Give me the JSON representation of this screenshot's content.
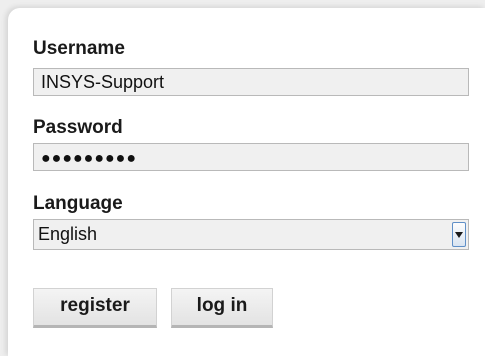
{
  "form": {
    "username": {
      "label": "Username",
      "value": "INSYS-Support"
    },
    "password": {
      "label": "Password",
      "masked_value": "●●●●●●●●●"
    },
    "language": {
      "label": "Language",
      "selected": "English"
    }
  },
  "buttons": {
    "register": "register",
    "login": "log in"
  }
}
